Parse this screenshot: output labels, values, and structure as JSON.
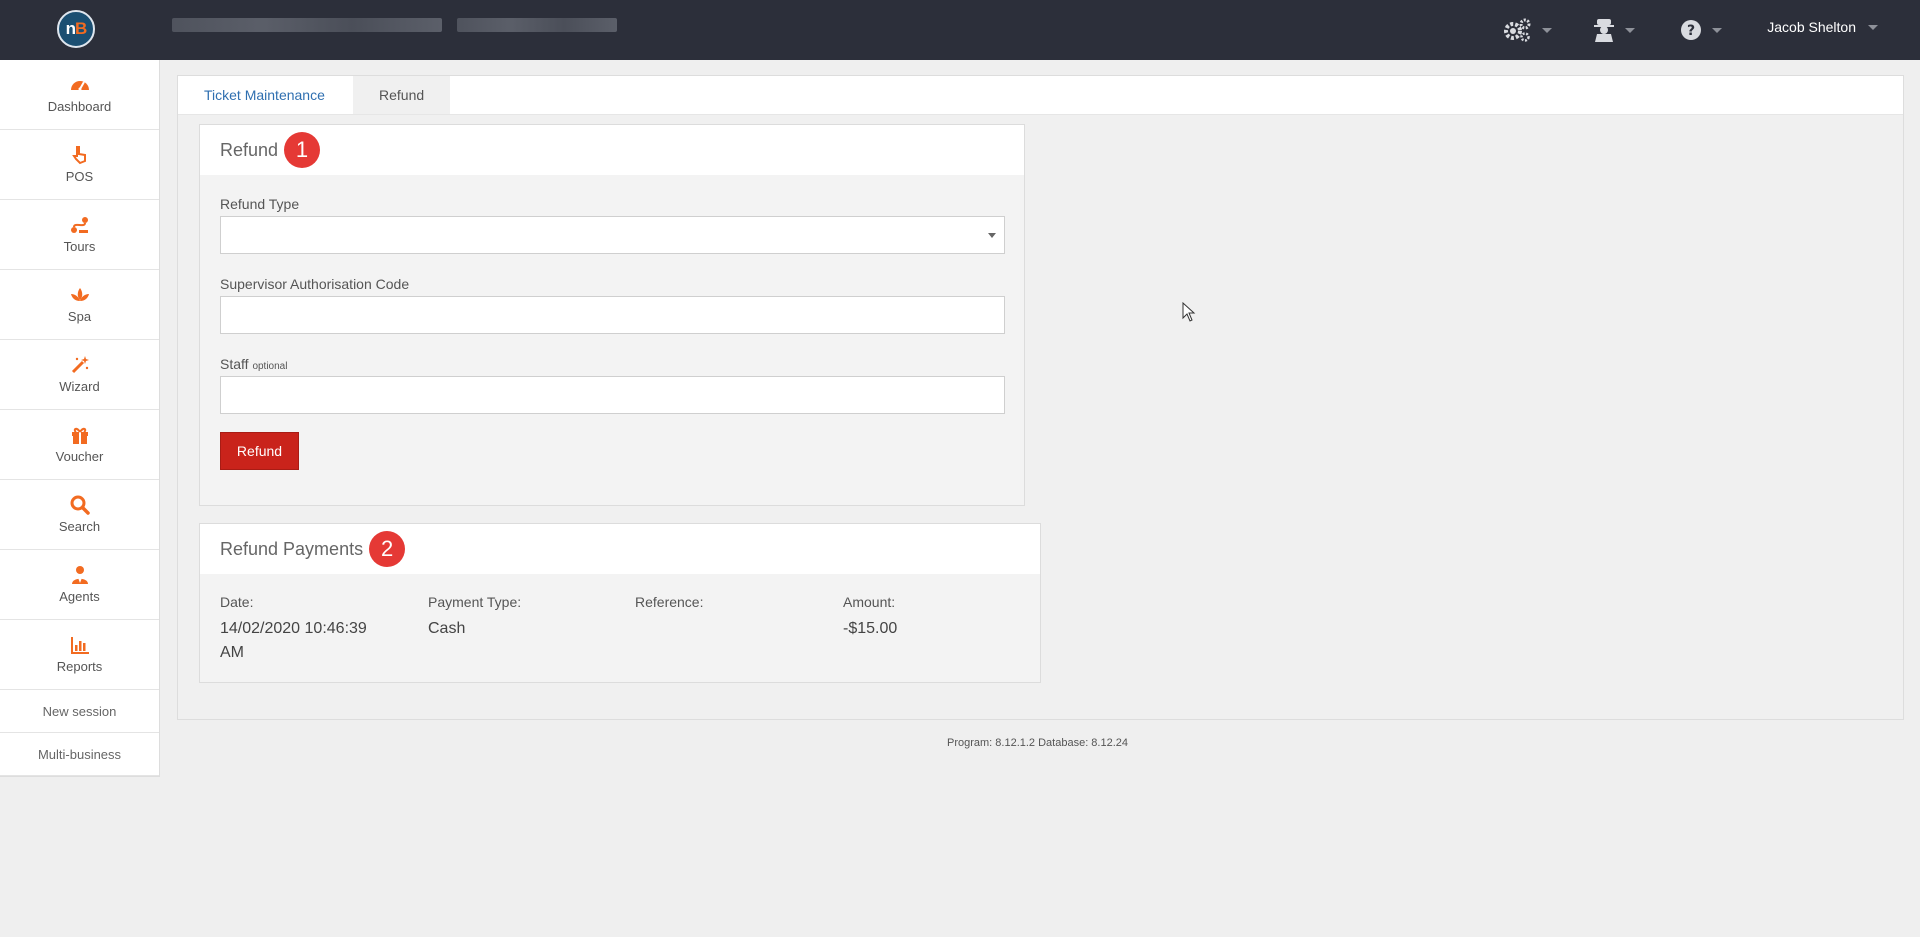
{
  "topbar": {
    "user_name": "Jacob Shelton",
    "icons": [
      "cogs-icon",
      "agent-icon",
      "help-icon"
    ]
  },
  "sidebar": {
    "items": [
      {
        "label": "Dashboard",
        "icon": "dashboard-icon"
      },
      {
        "label": "POS",
        "icon": "pointer-hand-icon"
      },
      {
        "label": "Tours",
        "icon": "route-icon"
      },
      {
        "label": "Spa",
        "icon": "lotus-icon"
      },
      {
        "label": "Wizard",
        "icon": "magic-wand-icon"
      },
      {
        "label": "Voucher",
        "icon": "gift-icon"
      },
      {
        "label": "Search",
        "icon": "search-icon"
      },
      {
        "label": "Agents",
        "icon": "user-tie-icon"
      },
      {
        "label": "Reports",
        "icon": "bar-chart-icon"
      }
    ],
    "links": [
      "New session",
      "Multi-business"
    ]
  },
  "tabs": [
    "Ticket Maintenance",
    "Refund"
  ],
  "refund_card": {
    "title": "Refund",
    "badge": "1",
    "refund_type_label": "Refund Type",
    "refund_type_value": "",
    "supervisor_label": "Supervisor Authorisation Code",
    "supervisor_value": "",
    "staff_label": "Staff",
    "staff_optional": "optional",
    "staff_value": "",
    "button_label": "Refund"
  },
  "payments_card": {
    "title": "Refund Payments",
    "badge": "2",
    "columns": [
      {
        "label": "Date:",
        "value": "14/02/2020 10:46:39 AM"
      },
      {
        "label": "Payment Type:",
        "value": "Cash"
      },
      {
        "label": "Reference:",
        "value": ""
      },
      {
        "label": "Amount:",
        "value": "-$15.00"
      }
    ]
  },
  "footer": "Program: 8.12.1.2 Database: 8.12.24",
  "colors": {
    "topbar": "#2c2f3a",
    "accent": "#f26b21",
    "button": "#c9231b",
    "badge": "#e53935",
    "link": "#2f6fb0"
  }
}
